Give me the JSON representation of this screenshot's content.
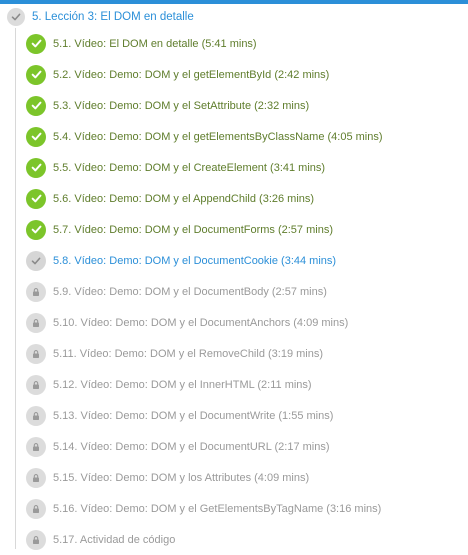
{
  "section": {
    "title": "5. Lección 3: El DOM en detalle",
    "status_icon": "check-icon"
  },
  "colors": {
    "accent": "#2b8fd8",
    "completed": "#7cc52a",
    "completed_text": "#5f7d2c",
    "locked_text": "#9a9a9a"
  },
  "lessons": [
    {
      "label": "5.1. Vídeo: El DOM en detalle (5:41 mins)",
      "status": "completed"
    },
    {
      "label": "5.2. Vídeo: Demo: DOM y el getElementById (2:42 mins)",
      "status": "completed"
    },
    {
      "label": "5.3. Vídeo: Demo: DOM y el SetAttribute (2:32 mins)",
      "status": "completed"
    },
    {
      "label": "5.4. Vídeo: Demo: DOM y el getElementsByClassName (4:05 mins)",
      "status": "completed"
    },
    {
      "label": "5.5. Vídeo: Demo: DOM y el CreateElement (3:41 mins)",
      "status": "completed"
    },
    {
      "label": "5.6. Vídeo: Demo: DOM y el AppendChild (3:26 mins)",
      "status": "completed"
    },
    {
      "label": "5.7. Vídeo: Demo: DOM y el DocumentForms (2:57 mins)",
      "status": "completed"
    },
    {
      "label": "5.8. Vídeo: Demo: DOM y el DocumentCookie (3:44 mins)",
      "status": "current"
    },
    {
      "label": "5.9. Vídeo: Demo: DOM y el DocumentBody (2:57 mins)",
      "status": "locked"
    },
    {
      "label": "5.10. Vídeo: Demo: DOM y el DocumentAnchors (4:09 mins)",
      "status": "locked"
    },
    {
      "label": "5.11. Vídeo: Demo: DOM y el RemoveChild (3:19 mins)",
      "status": "locked"
    },
    {
      "label": "5.12. Vídeo: Demo: DOM y el InnerHTML (2:11 mins)",
      "status": "locked"
    },
    {
      "label": "5.13. Vídeo: Demo: DOM y el DocumentWrite (1:55 mins)",
      "status": "locked"
    },
    {
      "label": "5.14. Vídeo: Demo: DOM y el DocumentURL (2:17 mins)",
      "status": "locked"
    },
    {
      "label": "5.15. Vídeo: Demo: DOM y los Attributes (4:09 mins)",
      "status": "locked"
    },
    {
      "label": "5.16. Vídeo: Demo: DOM y el GetElementsByTagName (3:16 mins)",
      "status": "locked"
    },
    {
      "label": "5.17. Actividad de código",
      "status": "locked"
    }
  ]
}
